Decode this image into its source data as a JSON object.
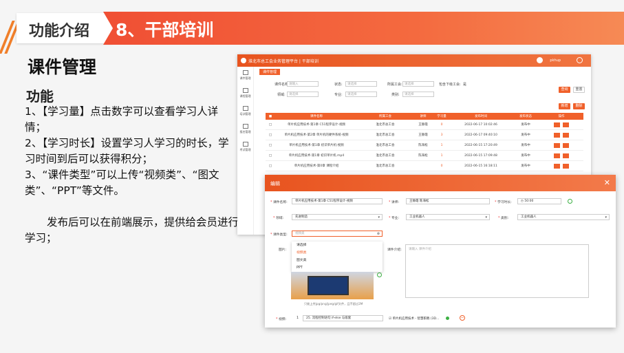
{
  "slide": {
    "tag": "功能介绍",
    "heading": "8、干部培训",
    "section_title": "课件管理",
    "func_title": "功能",
    "lines": [
      "1、【学习量】点击数字可以查看学习人详情；",
      "2、【学习时长】设置学习人学习的时长，学习时间到后可以获得积分；",
      "3、“课件类型”可以上传“视频类”、“图文类”、“PPT”等文件。"
    ],
    "publish_note": "发布后可以在前端展示，提供给会员进行学习；"
  },
  "app": {
    "title": "淮北市总工会业务管理平台 | 干部培训",
    "user": "pkhup",
    "sidebar": [
      "课件管理",
      "课程管理",
      "培训管理",
      "报名管理",
      "考试管理"
    ],
    "breadcrumb": "课件管理",
    "filters": {
      "name_label": "课件名称:",
      "name_placeholder": "请输入",
      "status_label": "状态:",
      "status_placeholder": "请选择",
      "union_label": "所属工会:",
      "union_placeholder": "请选择",
      "show_label": "包含下级工会:",
      "show_value": "是",
      "field_label": "领域:",
      "field_placeholder": "请选择",
      "major_label": "专业:",
      "major_placeholder": "请选择",
      "cat_label": "类别:",
      "cat_placeholder": "请选择"
    },
    "buttons": {
      "search": "查询",
      "reset": "重置",
      "add": "新增",
      "delete": "删除"
    },
    "columns": [
      "课件名称",
      "所属工会",
      "讲师",
      "学习量",
      "发布时间",
      "发布状态",
      "操作"
    ],
    "rows": [
      {
        "name": "单片机应用技术-第1章 C51程序设计-视频",
        "union": "淮北市总工会",
        "lecturer": "王静霞",
        "count": "0",
        "time": "2022-06-17 10:02:46",
        "status": "发布中"
      },
      {
        "name": "单片机应用技术-第2章 单片机的硬件系统-视频",
        "union": "淮北市总工会",
        "lecturer": "王静霞",
        "count": "3",
        "time": "2022-06-17 09:40:10",
        "status": "发布中"
      },
      {
        "name": "单片机应用技术-第1章 初识单片机-视频",
        "union": "淮北市总工会",
        "lecturer": "陈海松",
        "count": "1",
        "time": "2022-06-15 17:20:49",
        "status": "发布中"
      },
      {
        "name": "单片机应用技术-第1章 初识单片机.mp4",
        "union": "淮北市总工会",
        "lecturer": "陈海松",
        "count": "1",
        "time": "2022-06-15 17:09:48",
        "status": "发布中"
      },
      {
        "name": "单片机应用技术-第0章 课程介绍",
        "union": "淮北市总工会",
        "lecturer": "",
        "count": "0",
        "time": "2022-06-15 16:18:11",
        "status": "发布中"
      }
    ]
  },
  "modal": {
    "title": "编辑",
    "name_label": "课件名称:",
    "name_value": "单片机应用技术-第1章 C51程序设计-视频",
    "lecturer_label": "讲师:",
    "lecturer_value": "王静霞 陈海松",
    "duration_label": "学习时长:",
    "duration_value": "50:00",
    "field_label": "领域:",
    "field_value": "先进制造",
    "major_label": "专业:",
    "major_value": "工业机器人",
    "cat_label": "类别:",
    "cat_value": "工业机器人",
    "type_label": "课件类型:",
    "type_placeholder": "视频类",
    "type_options": [
      "请选择",
      "视频类",
      "图文类",
      "PPT"
    ],
    "image_label": "图片:",
    "upload_hint": "只能上传jpg/png/jpeg/gif文件，且不超过2M",
    "intro_label": "课件介绍:",
    "intro_placeholder": "请输入 课件介绍",
    "video_label": "视频:",
    "video_index": "1",
    "video_value": "25. 流程控制语句 if-else 与嵌套",
    "linked_value": "单片机应用技术 - 智慧职教 (3D..."
  }
}
